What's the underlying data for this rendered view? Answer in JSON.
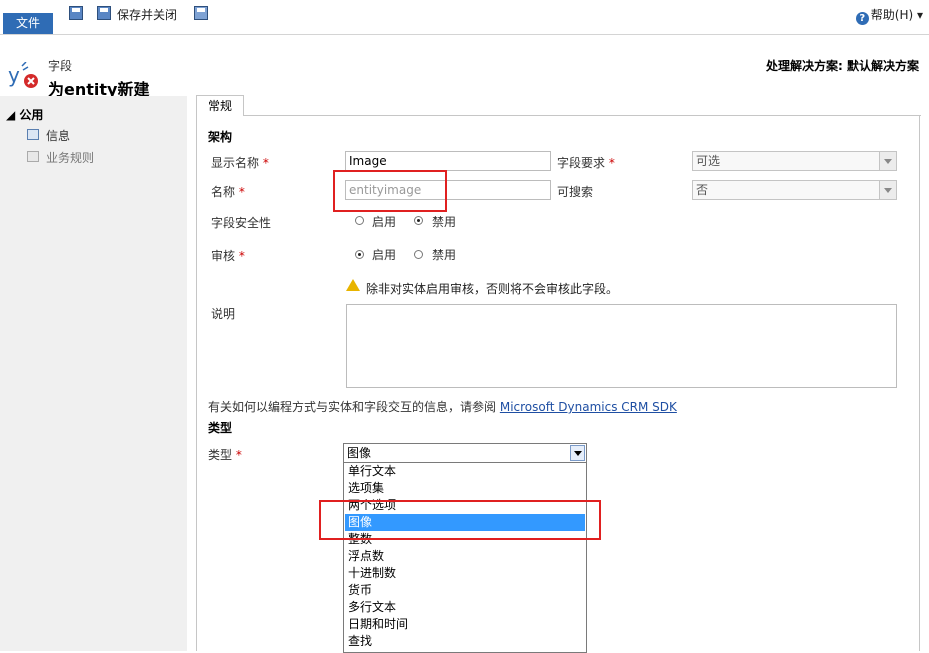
{
  "ribbon": {
    "file_tab": "文件",
    "save_close": "保存并关闭",
    "help": "帮助(H)",
    "help_icon": "question-mark-icon"
  },
  "header": {
    "entity_label": "字段",
    "title": "为entity新建",
    "solution": "处理解决方案: 默认解决方案"
  },
  "sidebar": {
    "group": "公用",
    "items": [
      {
        "label": "信息",
        "icon": "form-icon"
      },
      {
        "label": "业务规则",
        "icon": "rules-icon"
      }
    ]
  },
  "tabs": {
    "general": "常规"
  },
  "schema": {
    "section_title": "架构",
    "display_name_label": "显示名称",
    "display_name_value": "Image",
    "field_requirement_label": "字段要求",
    "field_requirement_value": "可选",
    "name_label": "名称",
    "name_value": "entityimage",
    "searchable_label": "可搜索",
    "searchable_value": "否",
    "field_security_label": "字段安全性",
    "field_security_options": [
      "启用",
      "禁用"
    ],
    "field_security_selected": "禁用",
    "audit_label": "审核",
    "audit_options": [
      "启用",
      "禁用"
    ],
    "audit_selected": "启用",
    "audit_warning": "除非对实体启用审核，否则将不会审核此字段。",
    "description_label": "说明",
    "sdk_text": "有关如何以编程方式与实体和字段交互的信息，请参阅",
    "sdk_link": "Microsoft Dynamics CRM SDK",
    "required_marker": "*"
  },
  "type_section": {
    "section_title": "类型",
    "type_label": "类型",
    "selected": "图像",
    "options": [
      "单行文本",
      "选项集",
      "两个选项",
      "图像",
      "整数",
      "浮点数",
      "十进制数",
      "货币",
      "多行文本",
      "日期和时间",
      "查找"
    ]
  },
  "colors": {
    "accent": "#2f6cb5",
    "highlight": "#3399ff",
    "annotation": "#e02020",
    "required": "#cc0000"
  }
}
